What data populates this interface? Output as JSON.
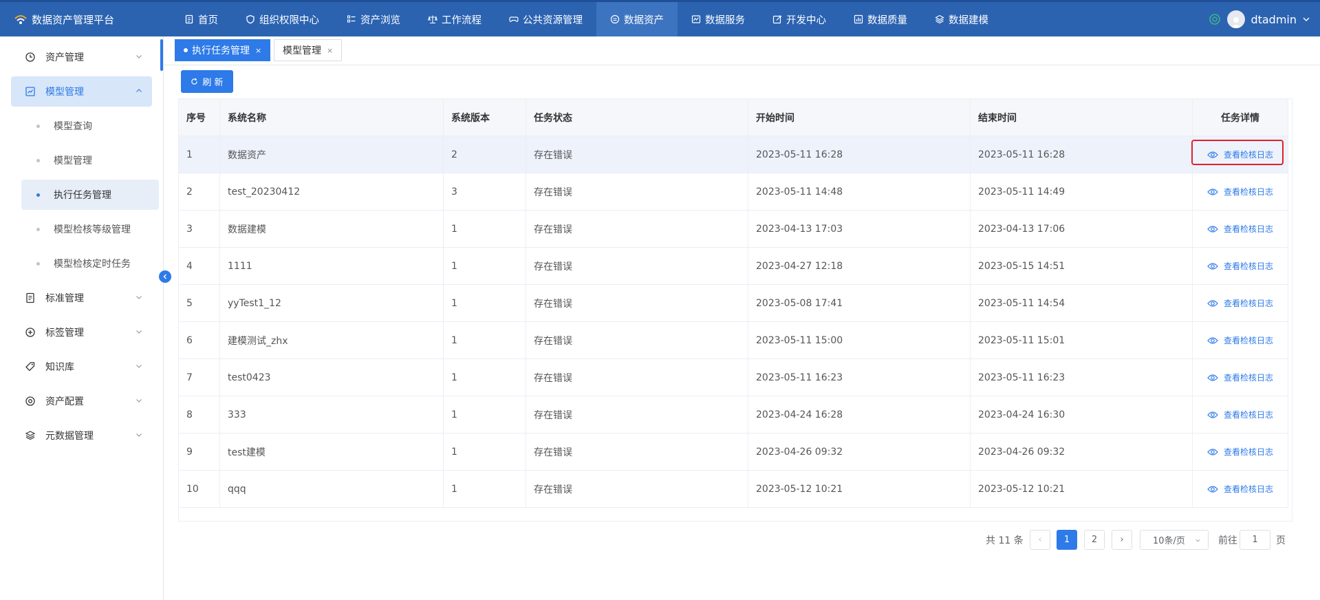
{
  "app": {
    "title": "数据资产管理平台"
  },
  "nav": [
    {
      "label": "首页",
      "icon": "doc-icon",
      "active": false
    },
    {
      "label": "组织权限中心",
      "icon": "shield-icon",
      "active": false
    },
    {
      "label": "资产浏览",
      "icon": "list-icon",
      "active": false
    },
    {
      "label": "工作流程",
      "icon": "scale-icon",
      "active": false
    },
    {
      "label": "公共资源管理",
      "icon": "gamepad-icon",
      "active": false
    },
    {
      "label": "数据资产",
      "icon": "database-icon",
      "active": true
    },
    {
      "label": "数据服务",
      "icon": "service-icon",
      "active": false
    },
    {
      "label": "开发中心",
      "icon": "edit-icon",
      "active": false
    },
    {
      "label": "数据质量",
      "icon": "chart-icon",
      "active": false
    },
    {
      "label": "数据建模",
      "icon": "layers-icon",
      "active": false
    }
  ],
  "user": {
    "name": "dtadmin"
  },
  "sidebar": {
    "top": [
      {
        "label": "资产管理",
        "icon": "clock-icon"
      },
      {
        "label": "模型管理",
        "icon": "line-chart-icon",
        "open": true
      }
    ],
    "sub": [
      {
        "label": "模型查询",
        "active": false
      },
      {
        "label": "模型管理",
        "active": false
      },
      {
        "label": "执行任务管理",
        "active": true
      },
      {
        "label": "模型检核等级管理",
        "active": false
      },
      {
        "label": "模型检核定时任务",
        "active": false
      }
    ],
    "bottom": [
      {
        "label": "标准管理",
        "icon": "document-icon"
      },
      {
        "label": "标签管理",
        "icon": "plus-circle-icon"
      },
      {
        "label": "知识库",
        "icon": "tag-icon"
      },
      {
        "label": "资产配置",
        "icon": "settings-icon"
      },
      {
        "label": "元数据管理",
        "icon": "stack-icon"
      }
    ]
  },
  "tabs": [
    {
      "label": "执行任务管理",
      "active": true,
      "close": "×"
    },
    {
      "label": "模型管理",
      "active": false,
      "close": "×"
    }
  ],
  "toolbar": {
    "refresh_label": "刷 新"
  },
  "table": {
    "headers": [
      "序号",
      "系统名称",
      "系统版本",
      "任务状态",
      "开始时间",
      "结束时间",
      "任务详情"
    ],
    "action_label": "查看检核日志",
    "rows": [
      [
        "1",
        "数据资产",
        "2",
        "存在错误",
        "2023-05-11 16:28",
        "2023-05-11 16:28"
      ],
      [
        "2",
        "test_20230412",
        "3",
        "存在错误",
        "2023-05-11 14:48",
        "2023-05-11 14:49"
      ],
      [
        "3",
        "数据建模",
        "1",
        "存在错误",
        "2023-04-13 17:03",
        "2023-04-13 17:06"
      ],
      [
        "4",
        "1111",
        "1",
        "存在错误",
        "2023-04-27 12:18",
        "2023-05-15 14:51"
      ],
      [
        "5",
        "yyTest1_12",
        "1",
        "存在错误",
        "2023-05-08 17:41",
        "2023-05-11 14:54"
      ],
      [
        "6",
        "建模测试_zhx",
        "1",
        "存在错误",
        "2023-05-11 15:00",
        "2023-05-11 15:01"
      ],
      [
        "7",
        "test0423",
        "1",
        "存在错误",
        "2023-05-11 16:23",
        "2023-05-11 16:23"
      ],
      [
        "8",
        "333",
        "1",
        "存在错误",
        "2023-04-24 16:28",
        "2023-04-24 16:30"
      ],
      [
        "9",
        "test建模",
        "1",
        "存在错误",
        "2023-04-26 09:32",
        "2023-04-26 09:32"
      ],
      [
        "10",
        "qqq",
        "1",
        "存在错误",
        "2023-05-12 10:21",
        "2023-05-12 10:21"
      ]
    ]
  },
  "pagination": {
    "total_text": "共 11 条",
    "prev": "‹",
    "pages": [
      "1",
      "2"
    ],
    "current": "1",
    "next": "›",
    "page_size": "10条/页",
    "goto_label": "前往",
    "goto_value": "1",
    "page_suffix": "页"
  },
  "colors": {
    "primary": "#2d7ae8",
    "topbar": "#2b63b1",
    "highlight": "#e0202a"
  }
}
